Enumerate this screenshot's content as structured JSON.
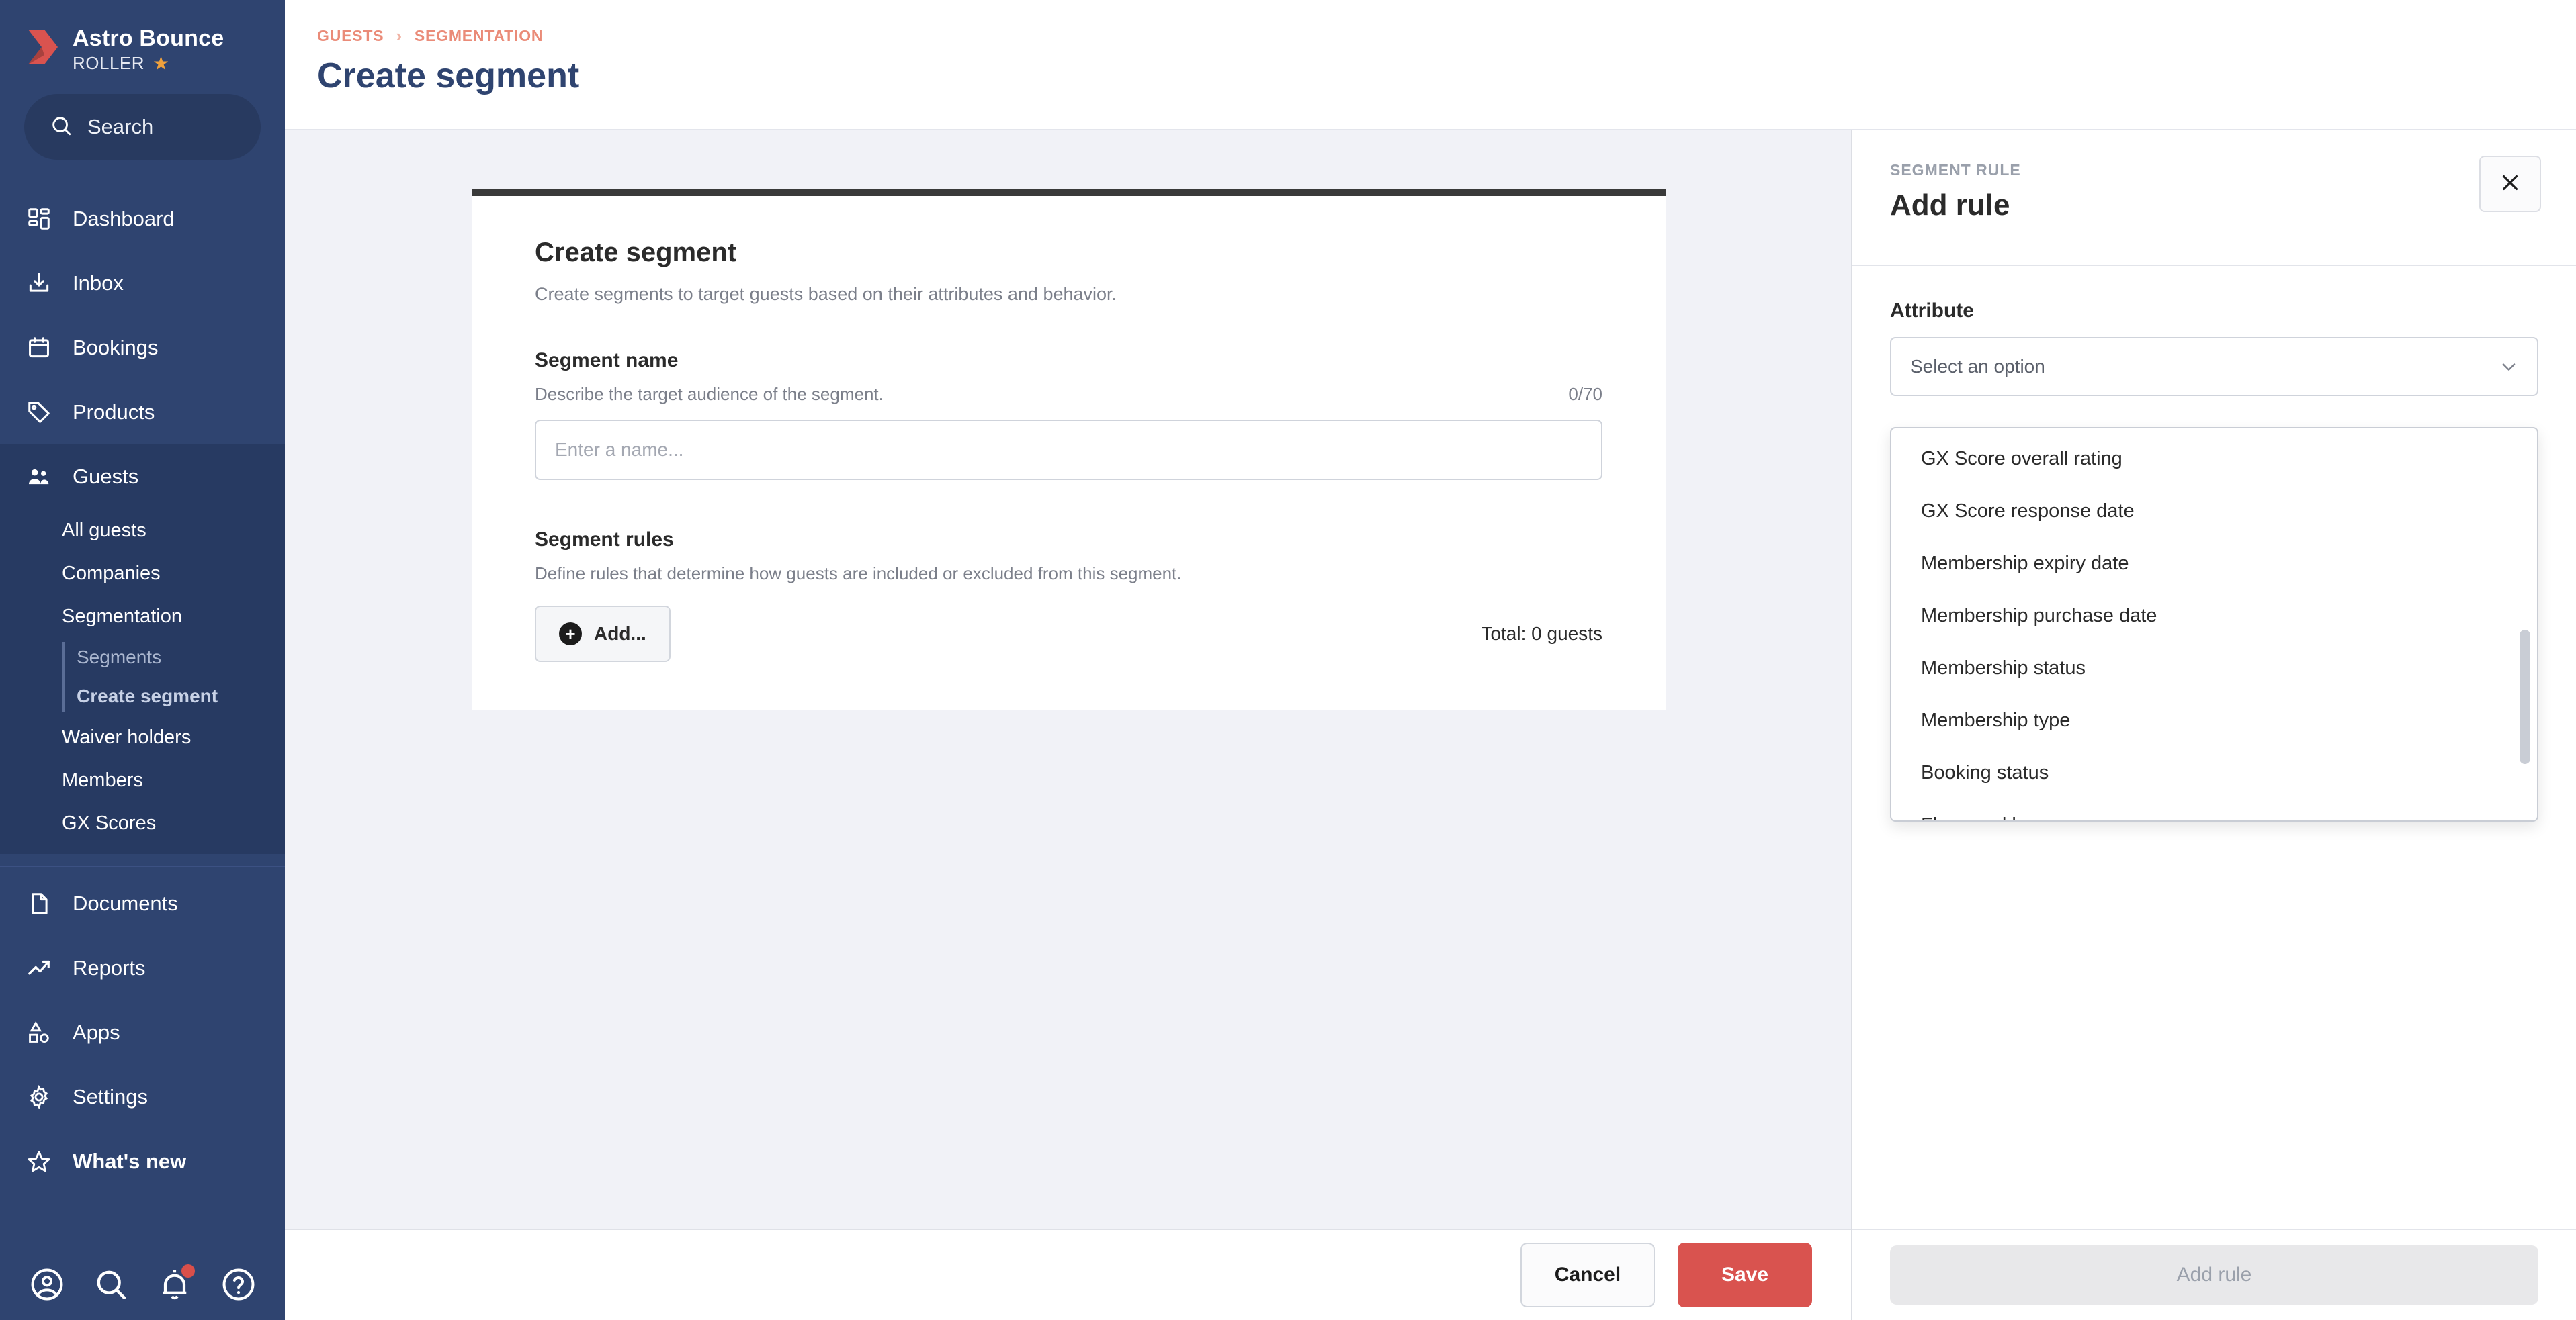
{
  "sidebar": {
    "brand": {
      "name": "Astro Bounce",
      "subtitle": "ROLLER",
      "star_icon": "star-icon"
    },
    "search": {
      "placeholder": "Search",
      "icon": "search-icon"
    },
    "nav": [
      {
        "label": "Dashboard",
        "icon": "dashboard-icon"
      },
      {
        "label": "Inbox",
        "icon": "inbox-icon"
      },
      {
        "label": "Bookings",
        "icon": "calendar-icon"
      },
      {
        "label": "Products",
        "icon": "tag-icon"
      },
      {
        "label": "Guests",
        "icon": "guests-icon"
      }
    ],
    "guests_subnav": [
      {
        "label": "All guests"
      },
      {
        "label": "Companies"
      },
      {
        "label": "Segmentation"
      }
    ],
    "segmentation_children": [
      {
        "label": "Segments",
        "selected": false
      },
      {
        "label": "Create segment",
        "selected": true
      }
    ],
    "guests_subnav_tail": [
      {
        "label": "Waiver holders"
      },
      {
        "label": "Members"
      },
      {
        "label": "GX Scores"
      }
    ],
    "nav_bottom": [
      {
        "label": "Documents",
        "icon": "document-icon"
      },
      {
        "label": "Reports",
        "icon": "chart-line-icon"
      },
      {
        "label": "Apps",
        "icon": "apps-icon"
      },
      {
        "label": "Settings",
        "icon": "gear-icon"
      },
      {
        "label": "What's new",
        "icon": "star-outline-icon"
      }
    ],
    "bottom_icons": [
      {
        "name": "account-icon"
      },
      {
        "name": "search-icon"
      },
      {
        "name": "bell-icon"
      },
      {
        "name": "help-icon"
      }
    ]
  },
  "header": {
    "breadcrumb": [
      "GUESTS",
      "SEGMENTATION"
    ],
    "separator": "›",
    "title": "Create segment"
  },
  "main": {
    "card_title": "Create segment",
    "card_subtitle": "Create segments to target guests based on their attributes and behavior.",
    "segment_name": {
      "label": "Segment name",
      "help": "Describe the target audience of the segment.",
      "char_count": "0/70",
      "placeholder": "Enter a name...",
      "value": ""
    },
    "segment_rules": {
      "label": "Segment rules",
      "help": "Define rules that determine how guests are included or excluded from this segment.",
      "add_button": "Add...",
      "add_icon": "plus-circle-icon",
      "total": "Total: 0 guests"
    },
    "footer": {
      "cancel_label": "Cancel",
      "save_label": "Save"
    }
  },
  "drawer": {
    "eyebrow": "SEGMENT RULE",
    "title": "Add rule",
    "close_icon": "close-icon",
    "attribute_label": "Attribute",
    "select_placeholder": "Select an option",
    "chevron_icon": "chevron-down-icon",
    "options": [
      "GX Score overall rating",
      "GX Score response date",
      "Membership expiry date",
      "Membership purchase date",
      "Membership status",
      "Membership type",
      "Booking status",
      "Flags and bans"
    ],
    "add_rule_label": "Add rule"
  },
  "colors": {
    "sidebar_bg": "#2f4470",
    "sidebar_active": "#273a62",
    "brand_red": "#d9534f",
    "breadcrumb": "#ea8b78",
    "title_navy": "#2f4470",
    "page_bg": "#f1f2f7",
    "card_top_border": "#3a3a3a",
    "star_gold": "#f0a13c"
  }
}
